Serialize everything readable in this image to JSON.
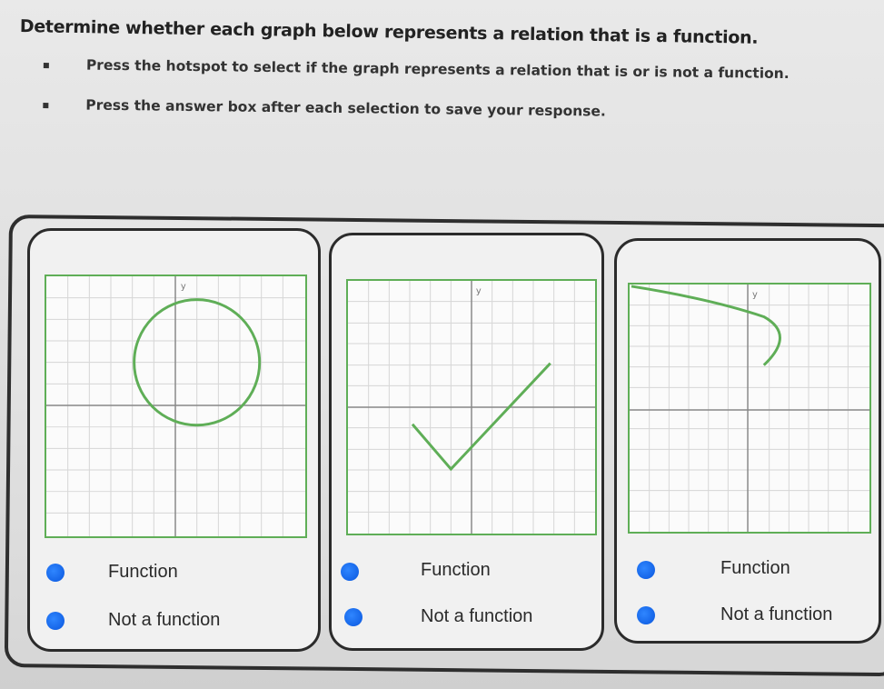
{
  "title": "Determine whether each graph below represents a relation that is a function.",
  "instructions": [
    "Press the hotspot to select if the graph represents a relation that is or is not a function.",
    "Press the answer box after each selection to save your response."
  ],
  "cards": [
    {
      "graph_shape": "circle",
      "option_function": "Function",
      "option_not_function": "Not a function"
    },
    {
      "graph_shape": "check-mark",
      "option_function": "Function",
      "option_not_function": "Not a function"
    },
    {
      "graph_shape": "sideways-curve",
      "option_function": "Function",
      "option_not_function": "Not a function"
    }
  ],
  "colors": {
    "graph_line": "#5fae57",
    "radio": "#1565e8",
    "frame": "#2b2b2b"
  },
  "axis_label": "y"
}
